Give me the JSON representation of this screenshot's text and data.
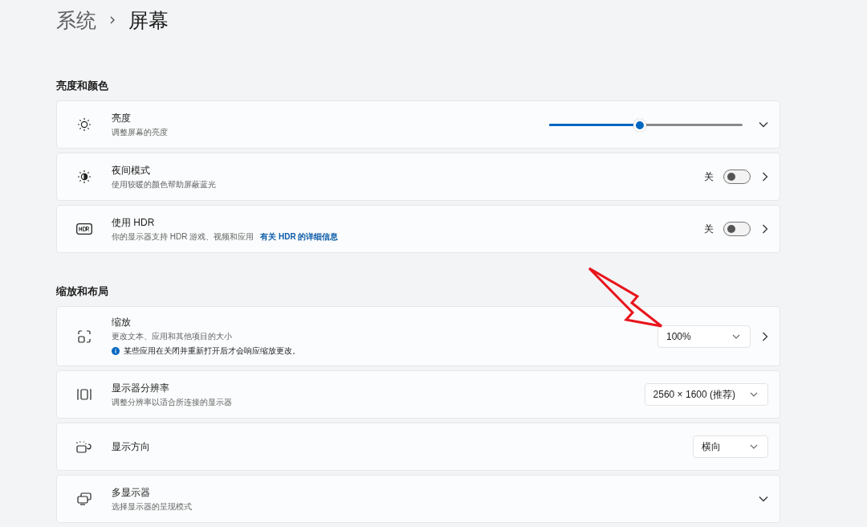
{
  "breadcrumb": {
    "parent": "系统",
    "current": "屏幕"
  },
  "sections": [
    {
      "title": "亮度和颜色",
      "rows": [
        {
          "kind": "slider",
          "title": "亮度",
          "subtitle": "调整屏幕的亮度",
          "level": 0.47,
          "expandable": true,
          "opens_page": false
        },
        {
          "kind": "toggle",
          "title": "夜间模式",
          "subtitle": "使用较暖的颜色帮助屏蔽蓝光",
          "state_label": "关",
          "on": false,
          "expandable": false,
          "opens_page": true
        },
        {
          "kind": "toggle",
          "title": "使用 HDR",
          "subtitle": "你的显示器支持 HDR 游戏、视频和应用",
          "link": "有关 HDR 的详细信息",
          "state_label": "关",
          "on": false,
          "expandable": false,
          "opens_page": true
        }
      ]
    },
    {
      "title": "缩放和布局",
      "rows": [
        {
          "kind": "dropdown",
          "title": "缩放",
          "subtitle": "更改文本、应用和其他项目的大小",
          "note": "某些应用在关闭并重新打开后才会响应缩放更改。",
          "value": "100%",
          "expandable": false,
          "opens_page": true
        },
        {
          "kind": "dropdown",
          "title": "显示器分辨率",
          "subtitle": "调整分辨率以适合所连接的显示器",
          "value": "2560 × 1600 (推荐)",
          "expandable": false,
          "opens_page": false
        },
        {
          "kind": "dropdown",
          "title": "显示方向",
          "value": "横向",
          "expandable": false,
          "opens_page": false
        },
        {
          "kind": "plain",
          "title": "多显示器",
          "subtitle": "选择显示器的呈现模式",
          "expandable": true,
          "opens_page": false
        }
      ]
    }
  ]
}
